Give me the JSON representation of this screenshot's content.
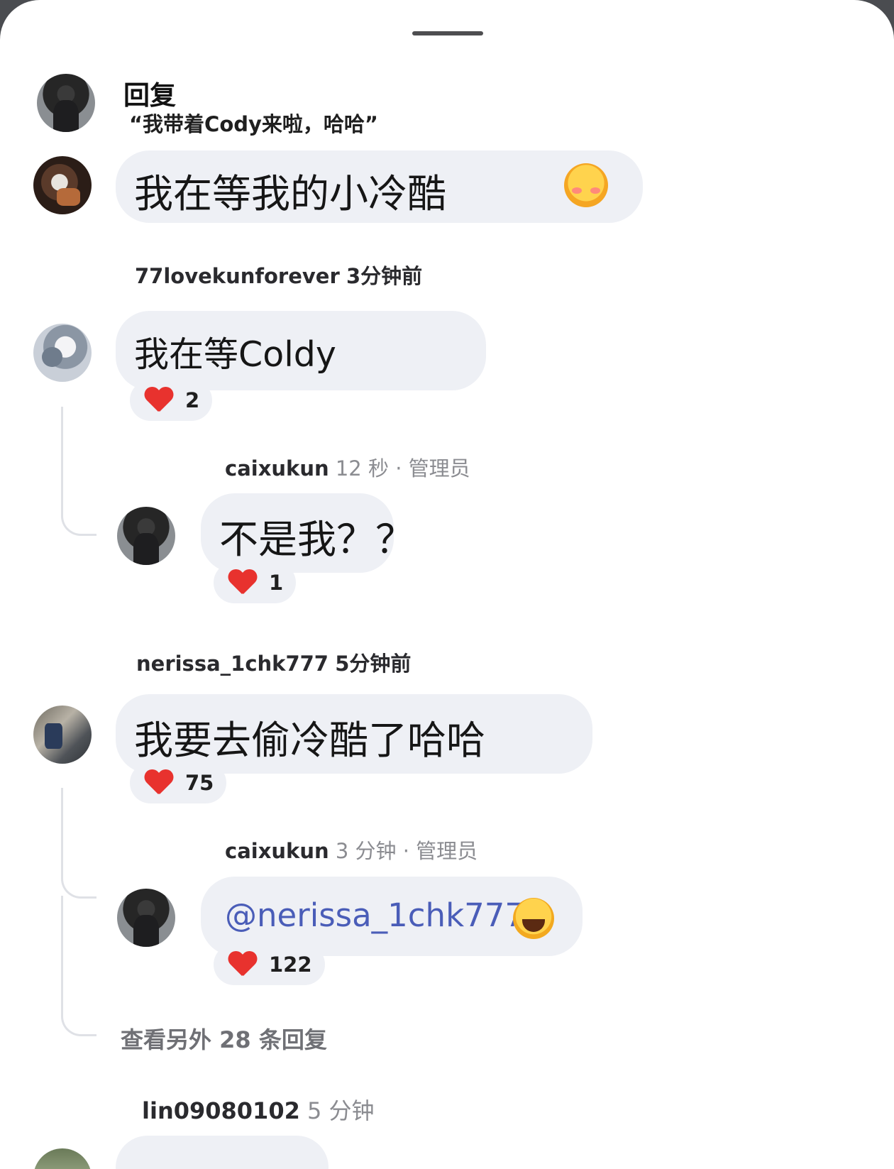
{
  "sheet": {
    "reply_label": "回复",
    "reply_quote": "“我带着Cody来啦，哈哈”"
  },
  "composer": {
    "text": "我在等我的小冷酷",
    "emoji": "smiling-face-with-hearts-icon"
  },
  "comments": [
    {
      "username": "77lovekunforever",
      "time": "3分钟前",
      "text": "我在等Coldy",
      "likes": "2"
    },
    {
      "username": "caixukun",
      "time": "12 秒 · 管理员",
      "text": "不是我？？",
      "likes": "1"
    },
    {
      "username": "nerissa_1chk777",
      "time": "5分钟前",
      "text": "我要去偷冷酷了哈哈",
      "likes": "75"
    },
    {
      "username": "caixukun",
      "time": "3 分钟 · 管理员",
      "mention": "@nerissa_1chk777",
      "emoji": "face-with-tears-of-joy-icon",
      "likes": "122"
    }
  ],
  "view_more": "查看另外 28 条回复",
  "next_comment": {
    "username": "lin09080102",
    "time": "5 分钟"
  },
  "colors": {
    "bubble_bg": "#eef0f5",
    "heart": "#e8322e",
    "mention": "#4a5db8",
    "muted_text": "#8b8c91"
  }
}
